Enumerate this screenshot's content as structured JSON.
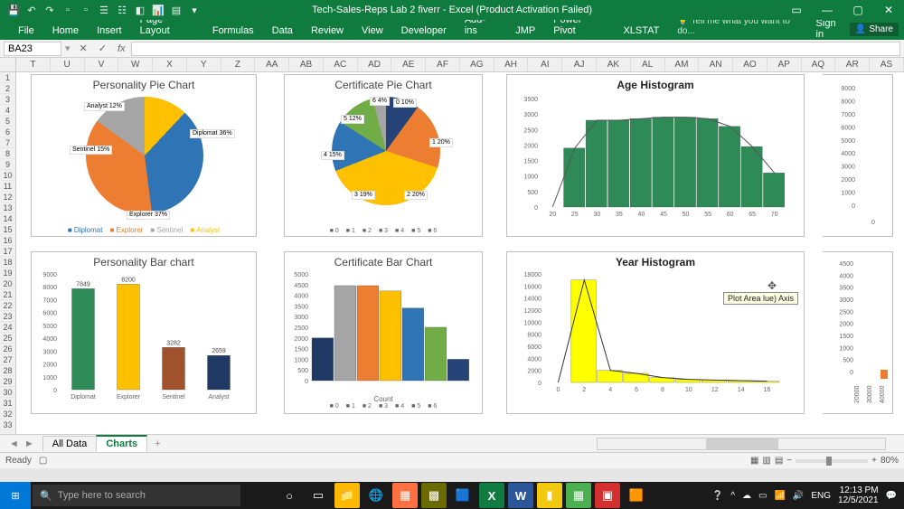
{
  "titlebar": {
    "title": "Tech-Sales-Reps  Lab 2 fiverr - Excel (Product Activation Failed)"
  },
  "ribbon": {
    "tabs": [
      "File",
      "Home",
      "Insert",
      "Page Layout",
      "Formulas",
      "Data",
      "Review",
      "View",
      "Developer",
      "Add-ins",
      "JMP",
      "Power Pivot",
      "XLSTAT"
    ],
    "tellme": "Tell me what you want to do...",
    "signin": "Sign in",
    "share": "Share"
  },
  "fx": {
    "namebox": "BA23"
  },
  "columns": [
    "T",
    "U",
    "V",
    "W",
    "X",
    "Y",
    "Z",
    "AA",
    "AB",
    "AC",
    "AD",
    "AE",
    "AF",
    "AG",
    "AH",
    "AI",
    "AJ",
    "AK",
    "AL",
    "AM",
    "AN",
    "AO",
    "AP",
    "AQ",
    "AR",
    "AS"
  ],
  "rows_start": 1,
  "rows_end": 33,
  "chart_data": [
    {
      "type": "pie",
      "title": "Personality Pie Chart",
      "series": [
        {
          "name": "Diplomat",
          "value": 36,
          "color": "#2f74b5"
        },
        {
          "name": "Explorer",
          "value": 37,
          "color": "#ed7d31"
        },
        {
          "name": "Sentinel",
          "value": 15,
          "color": "#a5a5a5"
        },
        {
          "name": "Analyst",
          "value": 12,
          "color": "#ffc000"
        }
      ],
      "labels": [
        "Diplomat 36%",
        "Explorer 37%",
        "Sentinel 15%",
        "Analyst 12%"
      ],
      "legend": [
        "Diplomat",
        "Explorer",
        "Sentinel",
        "Analyst"
      ]
    },
    {
      "type": "pie",
      "title": "Certificate Pie Chart",
      "series": [
        {
          "name": "0",
          "value": 10,
          "color": "#264478"
        },
        {
          "name": "1",
          "value": 20,
          "color": "#ed7d31"
        },
        {
          "name": "2",
          "value": 20,
          "color": "#ffc000"
        },
        {
          "name": "3",
          "value": 19,
          "color": "#ffc000"
        },
        {
          "name": "4",
          "value": 15,
          "color": "#2f74b5"
        },
        {
          "name": "5",
          "value": 12,
          "color": "#70ad47"
        },
        {
          "name": "6",
          "value": 4,
          "color": "#a5a5a5"
        }
      ],
      "labels": [
        "0 10%",
        "1 20%",
        "2 20%",
        "3 19%",
        "4 15%",
        "5 12%",
        "6 4%"
      ],
      "legend": [
        "0",
        "1",
        "2",
        "3",
        "4",
        "5",
        "6"
      ]
    },
    {
      "type": "bar",
      "title": "Age Histogram",
      "categories": [
        "20",
        "25",
        "30",
        "35",
        "40",
        "45",
        "50",
        "55",
        "60",
        "65",
        "70"
      ],
      "values": [
        0,
        1900,
        2800,
        2800,
        2850,
        2900,
        2900,
        2850,
        2600,
        1950,
        1100
      ],
      "ylim": [
        0,
        3500
      ],
      "ystep": 500,
      "color": "#2e8b57",
      "line_overlay": true
    },
    {
      "type": "bar",
      "title": "Personality Bar chart",
      "categories": [
        "Diplomat",
        "Explorer",
        "Sentinel",
        "Analyst"
      ],
      "values": [
        7849,
        8200,
        3282,
        2659
      ],
      "colors": [
        "#2e8b57",
        "#ffc000",
        "#a0522d",
        "#1f3864"
      ],
      "ylim": [
        0,
        9000
      ],
      "ystep": 1000,
      "data_labels": [
        "7849",
        "8200",
        "3282",
        "2659"
      ]
    },
    {
      "type": "bar",
      "title": "Certificate Bar Chart",
      "xlabel": "Count",
      "categories": [
        "0",
        "1",
        "2",
        "3",
        "4",
        "5",
        "6"
      ],
      "values": [
        2000,
        4450,
        4450,
        4200,
        3400,
        2500,
        1000
      ],
      "colors": [
        "#1f3864",
        "#a5a5a5",
        "#ed7d31",
        "#ffc000",
        "#2f74b5",
        "#70ad47",
        "#264478"
      ],
      "ylim": [
        0,
        5000
      ],
      "ystep": 500,
      "legend": [
        "0",
        "1",
        "2",
        "3",
        "4",
        "5",
        "6"
      ]
    },
    {
      "type": "bar",
      "title": "Year Histogram",
      "categories": [
        "0",
        "2",
        "4",
        "6",
        "8",
        "10",
        "12",
        "14",
        "16"
      ],
      "values": [
        0,
        17000,
        2000,
        1500,
        800,
        500,
        400,
        300,
        200
      ],
      "ylim": [
        0,
        18000
      ],
      "ystep": 2000,
      "color": "#ffff00",
      "line_overlay": true,
      "tooltip": "Plot Area  lue) Axis"
    },
    {
      "type": "bar",
      "title": "",
      "categories": [
        "0"
      ],
      "values": [
        0
      ],
      "ylim": [
        0,
        9000
      ],
      "ystep": 1000,
      "note": "right-top fragment"
    },
    {
      "type": "bar",
      "title": "",
      "categories": [
        "20000",
        "30000",
        "40000"
      ],
      "values": [
        0,
        0,
        500
      ],
      "ylim": [
        0,
        4500
      ],
      "ystep": 500,
      "color": "#ed7d31",
      "note": "right-bottom fragment"
    }
  ],
  "sheettabs": {
    "tabs": [
      "All Data",
      "Charts"
    ],
    "active": 1,
    "add": "+"
  },
  "statusbar": {
    "ready": "Ready",
    "zoom": "80%"
  },
  "taskbar": {
    "search_placeholder": "Type here to search",
    "time": "12:13 PM",
    "date": "12/5/2021",
    "lang": "ENG"
  }
}
